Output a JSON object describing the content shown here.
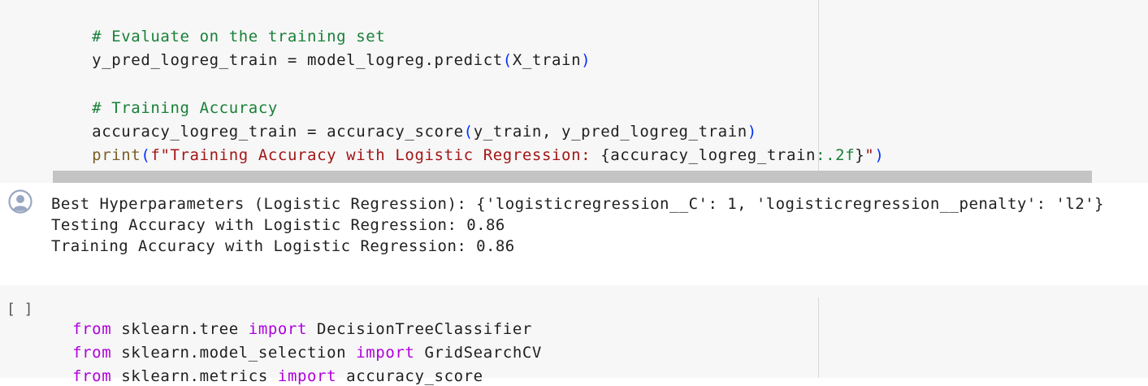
{
  "cell1": {
    "lines": [
      {
        "segments": [
          {
            "t": "# Evaluate on the training set",
            "c": "c-comment"
          }
        ]
      },
      {
        "segments": [
          {
            "t": "y_pred_logreg_train = model_logreg.predict",
            "c": "c-ink"
          },
          {
            "t": "(",
            "c": "c-paren"
          },
          {
            "t": "X_train",
            "c": "c-ink"
          },
          {
            "t": ")",
            "c": "c-paren"
          }
        ]
      },
      {
        "segments": [
          {
            "t": "# Training Accuracy",
            "c": "c-comment"
          }
        ]
      },
      {
        "segments": [
          {
            "t": "accuracy_logreg_train = accuracy_score",
            "c": "c-ink"
          },
          {
            "t": "(",
            "c": "c-paren"
          },
          {
            "t": "y_train, y_pred_logreg_train",
            "c": "c-ink"
          },
          {
            "t": ")",
            "c": "c-paren"
          }
        ]
      },
      {
        "segments": [
          {
            "t": "print",
            "c": "c-func"
          },
          {
            "t": "(",
            "c": "c-paren"
          },
          {
            "t": "f\"Training Accuracy with Logistic Regression: ",
            "c": "c-str"
          },
          {
            "t": "{",
            "c": "c-ink"
          },
          {
            "t": "accuracy_logreg_train",
            "c": "c-ink"
          },
          {
            "t": ":.2f",
            "c": "c-comment"
          },
          {
            "t": "}",
            "c": "c-ink"
          },
          {
            "t": "\"",
            "c": "c-str"
          },
          {
            "t": ")",
            "c": "c-paren"
          }
        ]
      }
    ]
  },
  "output": {
    "lines": [
      "Best Hyperparameters (Logistic Regression): {'logisticregression__C': 1, 'logisticregression__penalty': 'l2'}",
      "Testing Accuracy with Logistic Regression: 0.86",
      "Training Accuracy with Logistic Regression: 0.86"
    ],
    "avatar_icon": "user-avatar-icon"
  },
  "cell2": {
    "run_indicator": "[ ]",
    "lines": [
      {
        "segments": [
          {
            "t": "from",
            "c": "c-kw"
          },
          {
            "t": " sklearn.tree ",
            "c": "c-ink"
          },
          {
            "t": "import",
            "c": "c-kw"
          },
          {
            "t": " DecisionTreeClassifier",
            "c": "c-ink"
          }
        ]
      },
      {
        "segments": [
          {
            "t": "from",
            "c": "c-kw"
          },
          {
            "t": " sklearn.model_selection ",
            "c": "c-ink"
          },
          {
            "t": "import",
            "c": "c-kw"
          },
          {
            "t": " GridSearchCV",
            "c": "c-ink"
          }
        ]
      },
      {
        "segments": [
          {
            "t": "from",
            "c": "c-kw"
          },
          {
            "t": " sklearn.metrics ",
            "c": "c-ink"
          },
          {
            "t": "import",
            "c": "c-kw"
          },
          {
            "t": " accuracy_score",
            "c": "c-ink"
          }
        ]
      }
    ]
  }
}
